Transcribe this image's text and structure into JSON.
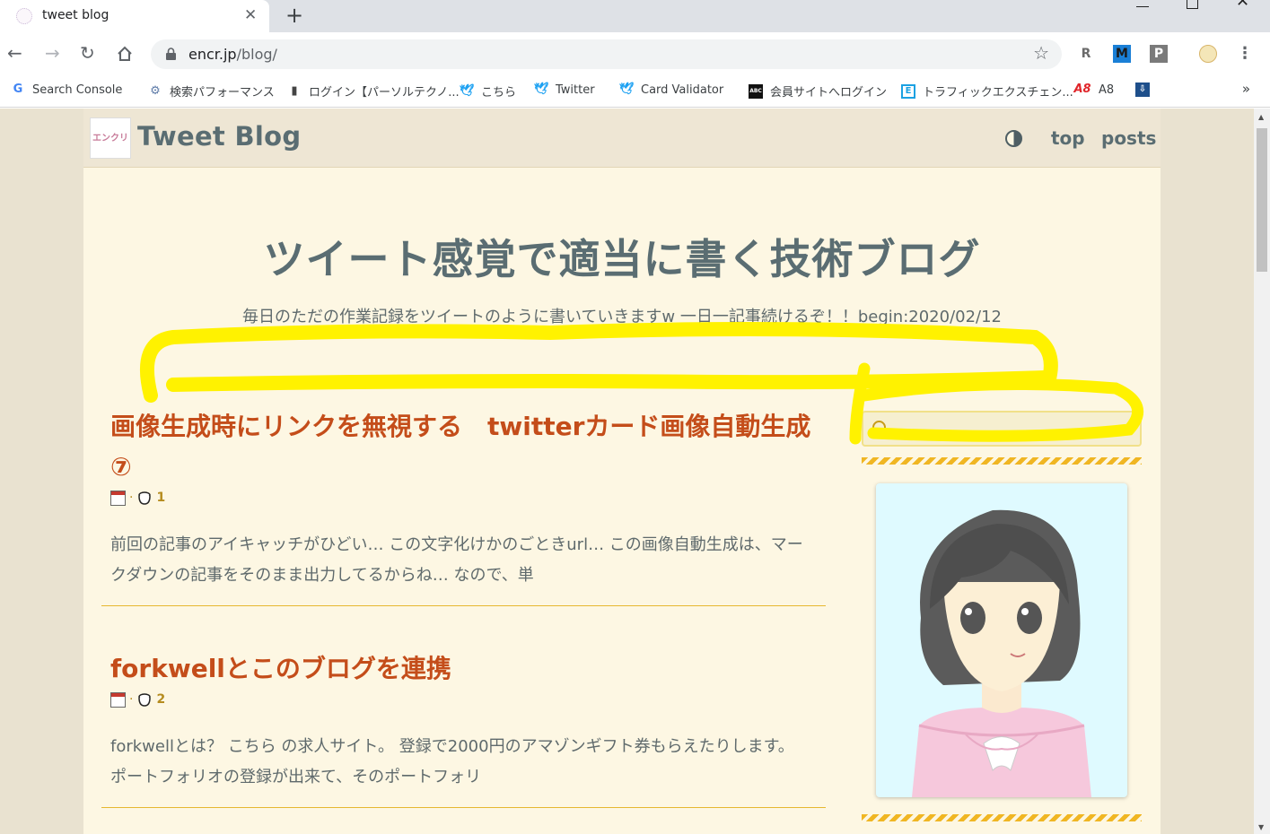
{
  "browser": {
    "tab_title": "tweet blog",
    "url_host": "encr.jp",
    "url_path": "/blog/",
    "bookmarks": [
      {
        "label": "Search Console",
        "icon": "google-icon"
      },
      {
        "label": "検索パフォーマンス",
        "icon": "search-console-icon"
      },
      {
        "label": "ログイン【パーソルテクノ...",
        "icon": "persol-icon"
      },
      {
        "label": "こちら",
        "icon": "twitter-icon"
      },
      {
        "label": "Twitter",
        "icon": "twitter-icon"
      },
      {
        "label": "Card Validator",
        "icon": "twitter-icon"
      },
      {
        "label": "会員サイトへログイン",
        "icon": "abc-icon"
      },
      {
        "label": "トラフィックエクスチェン...",
        "icon": "traffic-icon"
      },
      {
        "label": "A8",
        "icon": "a8-icon"
      }
    ],
    "extensions": [
      "R",
      "M",
      "P"
    ]
  },
  "site": {
    "logo_text": "エンクリ",
    "title": "Tweet Blog",
    "nav": {
      "top": "top",
      "posts": "posts"
    },
    "hero_title": "ツイート感覚で適当に書く技術ブログ",
    "hero_subtitle": "毎日のただの作業記録をツイートのように書いていきますw 一日一記事続けるぞ！！begin:2020/02/12"
  },
  "posts": [
    {
      "title": "画像生成時にリンクを無視する　twitterカード画像自動生成⑦",
      "separator": "·",
      "count": "1",
      "excerpt": "前回の記事のアイキャッチがひどい… この文字化けかのごときurl… この画像自動生成は、マークダウンの記事をそのまま出力してるからね… なので、単"
    },
    {
      "title": "forkwellとこのブログを連携",
      "separator": "·",
      "count": "2",
      "excerpt": "forkwellとは？ こちら の求人サイト。 登録で2000円のアマゾンギフト券もらえたりします。 ポートフォリオの登録が出来て、そのポートフォリ"
    }
  ],
  "colors": {
    "accent_title": "#c44d1a",
    "heading": "#5a6d72",
    "highlight_annotation": "#fff200"
  }
}
